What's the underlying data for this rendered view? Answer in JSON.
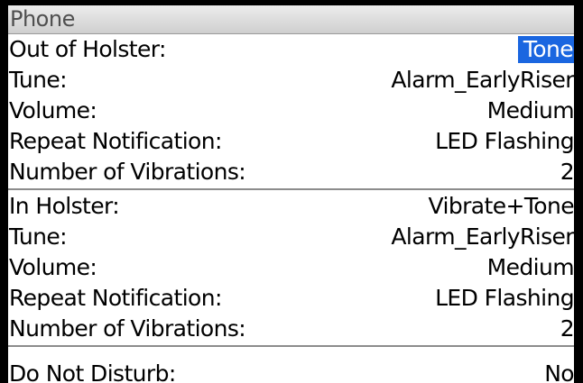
{
  "title": "Phone",
  "out_of_holster": {
    "label": "Out of Holster:",
    "value": "Tone",
    "tune_label": "Tune:",
    "tune_value": "Alarm_EarlyRiser",
    "volume_label": "Volume:",
    "volume_value": "Medium",
    "repeat_label": "Repeat Notification:",
    "repeat_value": "LED Flashing",
    "vibrations_label": "Number of Vibrations:",
    "vibrations_value": "2"
  },
  "in_holster": {
    "label": "In Holster:",
    "value": "Vibrate+Tone",
    "tune_label": "Tune:",
    "tune_value": "Alarm_EarlyRiser",
    "volume_label": "Volume:",
    "volume_value": "Medium",
    "repeat_label": "Repeat Notification:",
    "repeat_value": "LED Flashing",
    "vibrations_label": "Number of Vibrations:",
    "vibrations_value": "2"
  },
  "do_not_disturb": {
    "label": "Do Not Disturb:",
    "value": "No"
  },
  "colors": {
    "selection": "#1a66e0",
    "titlebar": "#dcdcdc"
  }
}
